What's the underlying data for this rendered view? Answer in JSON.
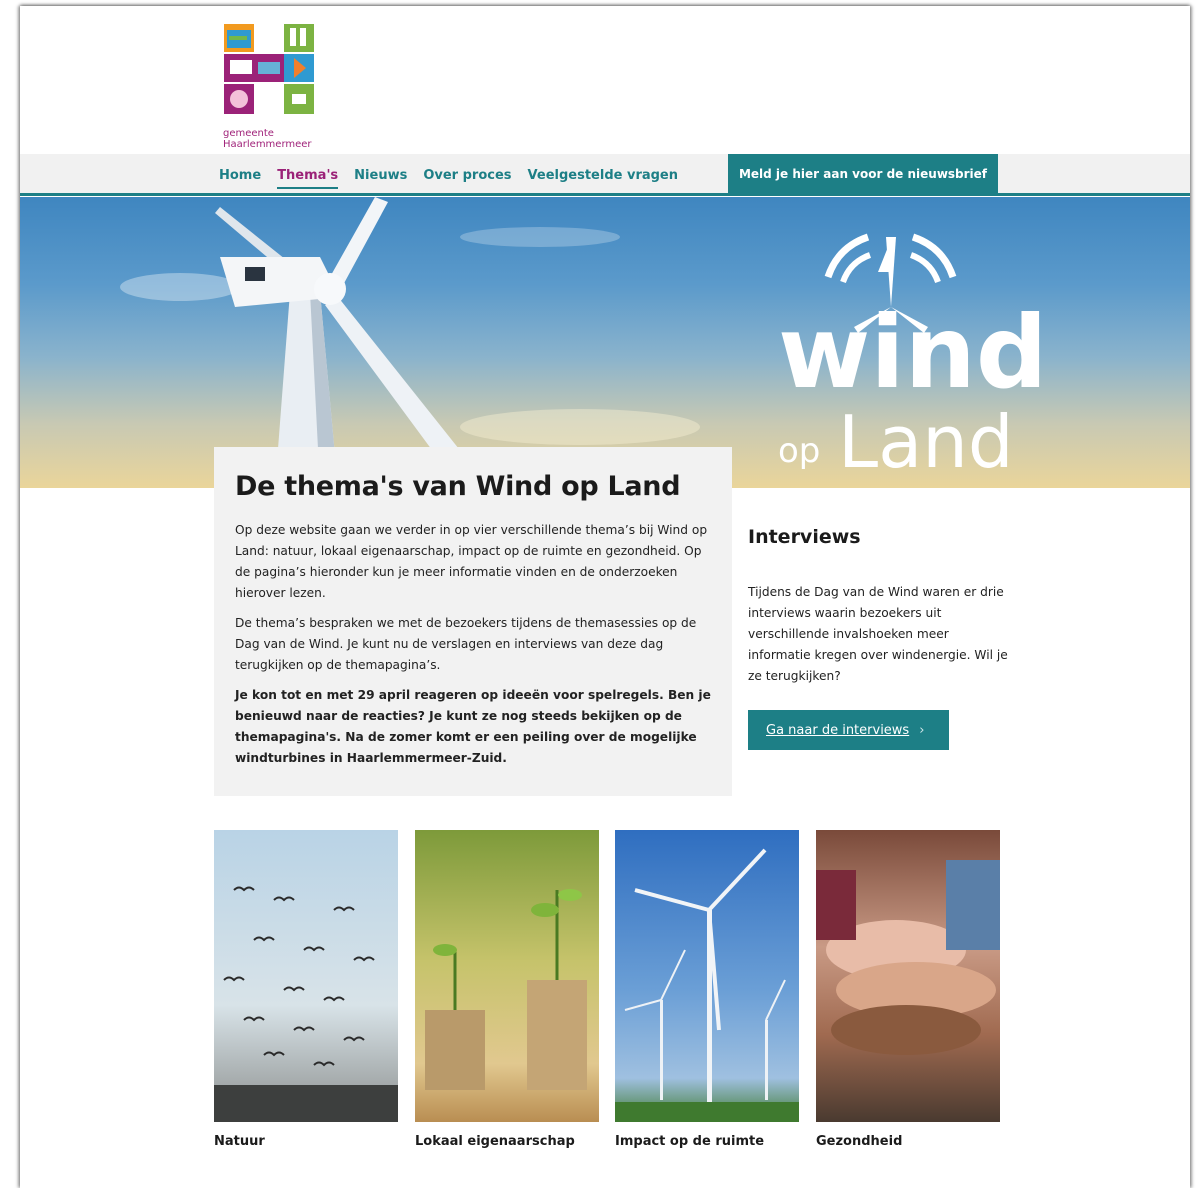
{
  "logo": {
    "line1": "gemeente",
    "line2": "Haarlemmermeer"
  },
  "nav": {
    "items": [
      {
        "label": "Home",
        "active": false
      },
      {
        "label": "Thema's",
        "active": true
      },
      {
        "label": "Nieuws",
        "active": false
      },
      {
        "label": "Over proces",
        "active": false
      },
      {
        "label": "Veelgestelde vragen",
        "active": false
      }
    ],
    "newsletter": "Meld je hier aan voor de nieuwsbrief"
  },
  "hero": {
    "logo_top": "wind",
    "logo_op": "op",
    "logo_bottom": "Land"
  },
  "intro": {
    "title": "De thema's van Wind op Land",
    "p1": "Op deze website gaan we verder in op vier verschillende thema’s bij Wind op Land: natuur, lokaal eigenaarschap, impact op de ruimte en gezondheid. Op de pagina’s hieronder kun je meer informatie vinden en de onderzoeken hierover lezen.",
    "p2": "De thema’s bespraken we met de bezoekers tijdens de themasessies op de Dag van de Wind. Je kunt nu de verslagen en interviews van deze dag terugkijken op de themapagina’s.",
    "p3": "Je kon tot en met 29 april reageren op ideeën voor spelregels. Ben je benieuwd naar de reacties? Je kunt ze nog steeds bekijken op de themapagina's. Na de zomer komt er een peiling over de mogelijke windturbines in Haarlemmermeer-Zuid."
  },
  "interviews": {
    "title": "Interviews",
    "body": "Tijdens de Dag van de Wind waren er drie interviews waarin bezoekers uit verschillende invalshoeken meer informatie kregen over windenergie. Wil je ze terugkijken?",
    "button": "Ga naar de interviews",
    "chevron": "›"
  },
  "themes": [
    {
      "label": "Natuur",
      "icon": "birds-image"
    },
    {
      "label": "Lokaal eigenaarschap",
      "icon": "coins-plants-image"
    },
    {
      "label": "Impact op de ruimte",
      "icon": "wind-turbines-image"
    },
    {
      "label": "Gezondheid",
      "icon": "hands-image"
    }
  ],
  "colors": {
    "teal": "#1d7f86",
    "magenta": "#9b2278",
    "card_bg": "#f2f2f2"
  }
}
